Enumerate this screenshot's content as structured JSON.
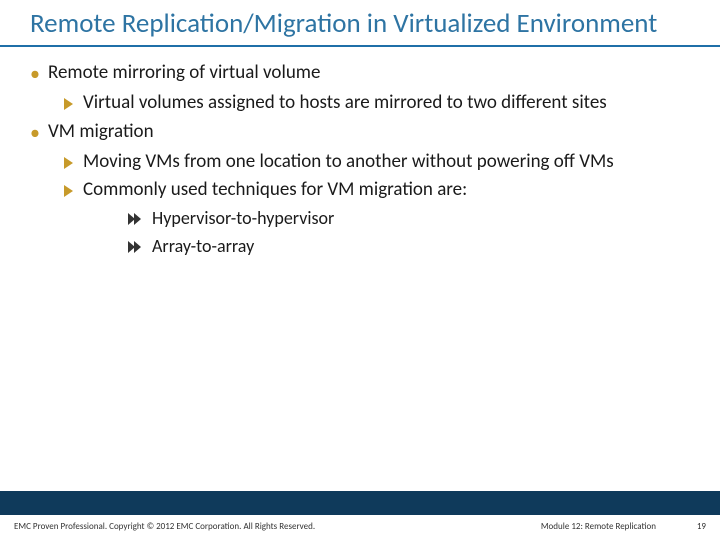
{
  "title": "Remote Replication/Migration in Virtualized Environment",
  "bullets": {
    "b1": "Remote mirroring of virtual volume",
    "b1_1": "Virtual volumes assigned to hosts are mirrored to two different sites",
    "b2": "VM migration",
    "b2_1": "Moving VMs from one location to another without powering off VMs",
    "b2_2": "Commonly used techniques for VM migration are:",
    "b2_2_1": "Hypervisor-to-hypervisor",
    "b2_2_2": "Array-to-array"
  },
  "footer": {
    "copyright": "EMC Proven Professional. Copyright © 2012 EMC Corporation. All Rights Reserved.",
    "module": "Module 12: Remote Replication",
    "page": "19"
  }
}
